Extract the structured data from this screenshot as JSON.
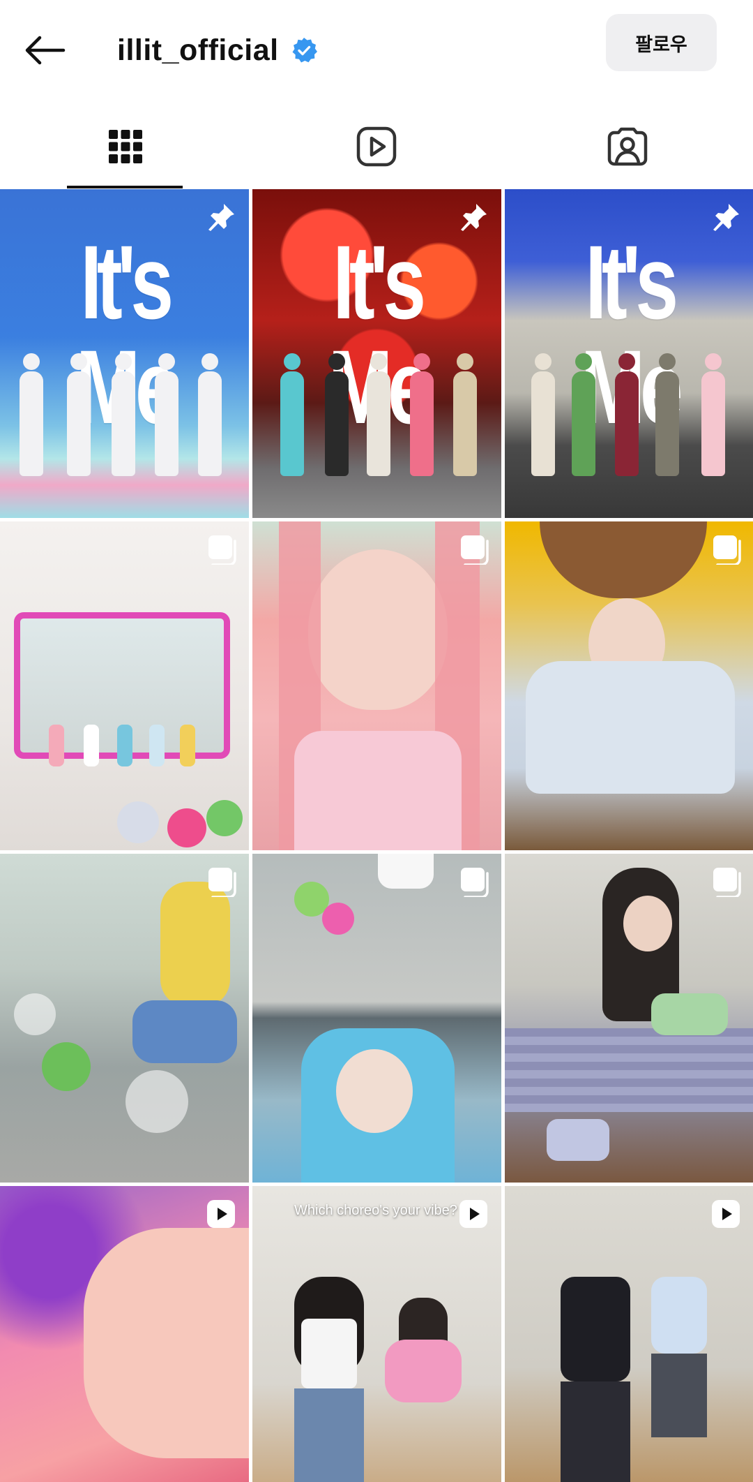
{
  "header": {
    "username": "illit_official",
    "follow_label": "팔로우"
  },
  "tabs": [
    {
      "name": "grid",
      "icon": "grid-icon",
      "active": true
    },
    {
      "name": "reels",
      "icon": "reels-icon",
      "active": false
    },
    {
      "name": "tagged",
      "icon": "tagged-icon",
      "active": false
    }
  ],
  "colors": {
    "verified_badge": "#3797f0",
    "follow_button_bg": "#efeff1",
    "text": "#111111"
  },
  "posts": [
    {
      "overlay_text": "It's Me",
      "badge": "pin-icon"
    },
    {
      "overlay_text": "It's Me",
      "badge": "pin-icon"
    },
    {
      "overlay_text": "It's Me",
      "badge": "pin-icon"
    },
    {
      "badge": "carousel-icon"
    },
    {
      "badge": "carousel-icon"
    },
    {
      "badge": "carousel-icon"
    },
    {
      "badge": "carousel-icon"
    },
    {
      "badge": "carousel-icon"
    },
    {
      "badge": "carousel-icon"
    },
    {
      "badge": "reel-icon"
    },
    {
      "caption": "Which choreo's your vibe?",
      "badge": "reel-icon"
    },
    {
      "badge": "reel-icon"
    }
  ]
}
